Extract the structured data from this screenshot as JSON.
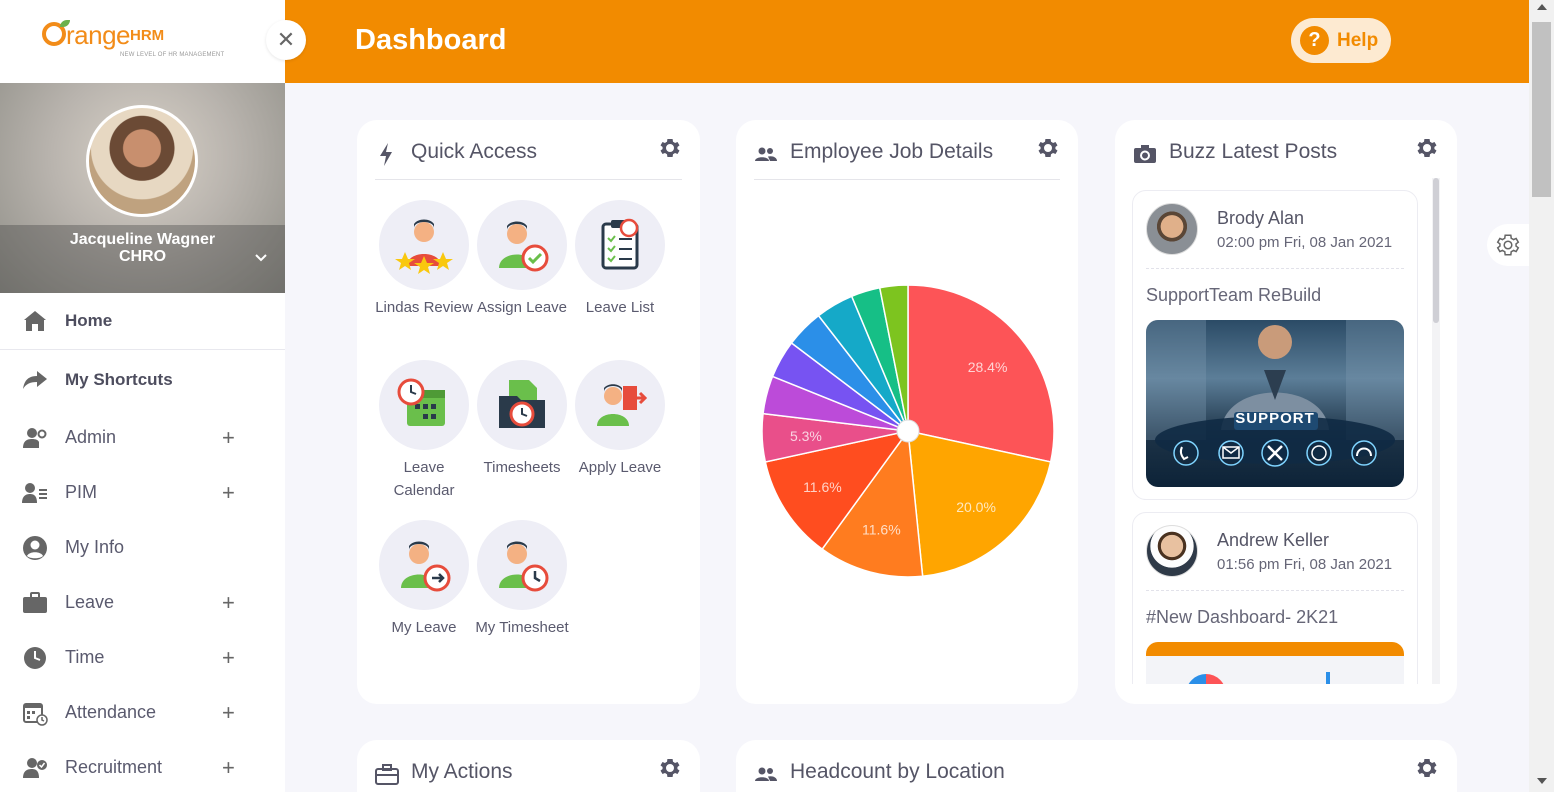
{
  "app": {
    "logo_text": "range",
    "logo_brand": "HRM",
    "logo_tagline": "NEW LEVEL OF HR MANAGEMENT"
  },
  "sidebar": {
    "close_symbol": "✕",
    "user": {
      "name": "Jacqueline Wagner",
      "role": "CHRO"
    },
    "items": [
      {
        "label": "Home",
        "icon": "home-icon"
      },
      {
        "label": "My Shortcuts",
        "icon": "share-icon"
      },
      {
        "label": "Admin",
        "icon": "user-cog-icon",
        "expandable": "+"
      },
      {
        "label": "PIM",
        "icon": "user-list-icon",
        "expandable": "+"
      },
      {
        "label": "My Info",
        "icon": "user-circle-icon"
      },
      {
        "label": "Leave",
        "icon": "briefcase-icon",
        "expandable": "+"
      },
      {
        "label": "Time",
        "icon": "clock-icon",
        "expandable": "+"
      },
      {
        "label": "Attendance",
        "icon": "calendar-icon",
        "expandable": "+"
      },
      {
        "label": "Recruitment",
        "icon": "user-check-icon",
        "expandable": "+"
      }
    ]
  },
  "header": {
    "title": "Dashboard",
    "help_symbol": "?",
    "help_label": "Help",
    "accent_color": "#f28b00"
  },
  "quick_access": {
    "title": "Quick Access",
    "items": [
      {
        "label": "Lindas Review"
      },
      {
        "label": "Assign Leave"
      },
      {
        "label": "Leave List"
      },
      {
        "label": "Leave Calendar"
      },
      {
        "label": "Timesheets"
      },
      {
        "label": "Apply Leave"
      },
      {
        "label": "My Leave"
      },
      {
        "label": "My Timesheet"
      }
    ]
  },
  "job_details": {
    "title": "Employee Job Details",
    "chart_data": {
      "type": "pie",
      "values": [
        28.4,
        20.0,
        11.6,
        11.6,
        5.3,
        4.2,
        4.2,
        4.2,
        4.2,
        3.2,
        3.1
      ],
      "labels": [
        "28.4%",
        "20.0%",
        "11.6%",
        "11.6%",
        "5.3%",
        "",
        "",
        "",
        "",
        "",
        ""
      ],
      "colors": [
        "#fd5457",
        "#ffa500",
        "#ff7c1f",
        "#ff4d1f",
        "#e94f8a",
        "#bc4bd9",
        "#7753f2",
        "#2b8fe8",
        "#15a9c8",
        "#16bf86",
        "#7dc41f"
      ]
    }
  },
  "buzz": {
    "title": "Buzz Latest Posts",
    "posts": [
      {
        "author": "Brody Alan",
        "time": "02:00 pm Fri, 08 Jan 2021",
        "text": "SupportTeam ReBuild",
        "image_caption": "SUPPORT"
      },
      {
        "author": "Andrew Keller",
        "time": "01:56 pm Fri, 08 Jan 2021",
        "text": "#New Dashboard- 2K21"
      }
    ]
  },
  "actions": {
    "title": "My Actions"
  },
  "headcount": {
    "title": "Headcount by Location"
  }
}
